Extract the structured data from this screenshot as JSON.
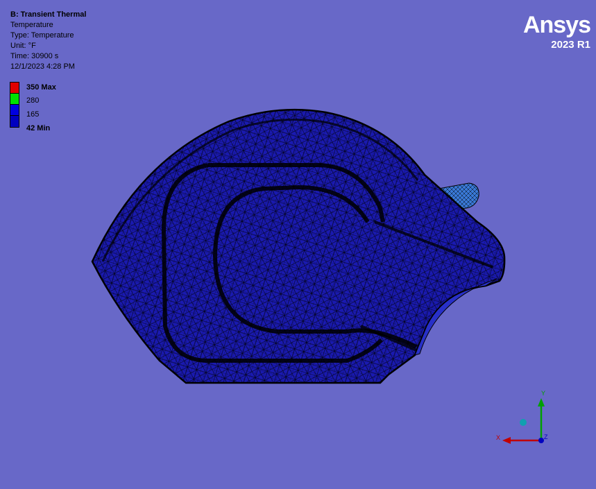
{
  "info": {
    "title": "B: Transient Thermal",
    "line1": "Temperature",
    "line2": "Type: Temperature",
    "line3": "Unit: °F",
    "line4": "Time: 30900 s",
    "line5": "12/1/2023 4:28 PM"
  },
  "legend": {
    "max_label": "350 Max",
    "mid_high_label": "280",
    "mid_low_label": "165",
    "min_label": "42 Min",
    "colors": [
      "#e00000",
      "#00e000",
      "#0000e0",
      "#0000a0"
    ]
  },
  "brand": {
    "name": "Ansys",
    "version": "2023 R1"
  },
  "triad": {
    "x_label": "X",
    "y_label": "Y",
    "z_label": "Z"
  },
  "colors": {
    "background": "#6868c8",
    "mesh_fill": "#1a1ab0",
    "mesh_line": "#000000",
    "x_axis": "#c00000",
    "y_axis": "#00a000",
    "z_axis": "#0000c0"
  }
}
